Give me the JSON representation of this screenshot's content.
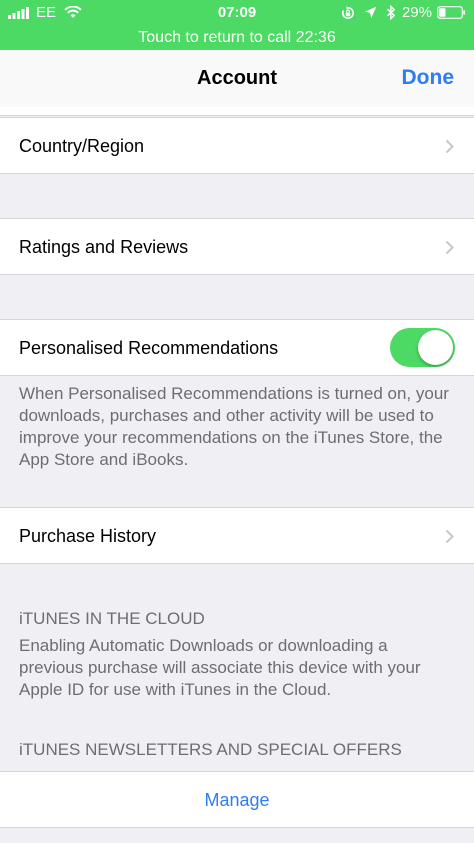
{
  "status_bar": {
    "carrier": "EE",
    "time": "07:09",
    "battery_percent": "29%",
    "battery_level": 0.29
  },
  "call_banner": {
    "text": "Touch to return to call 22:36"
  },
  "nav": {
    "title": "Account",
    "done_label": "Done"
  },
  "rows": {
    "country": "Country/Region",
    "ratings": "Ratings and Reviews",
    "personalised": "Personalised Recommendations",
    "purchase_history": "Purchase History"
  },
  "personalised_toggle_on": true,
  "personalised_footer": "When Personalised Recommendations is turned on, your downloads, purchases and other activity will be used to improve your recommendations on the iTunes Store, the App Store and iBooks.",
  "itunes_cloud": {
    "header": "iTUNES IN THE CLOUD",
    "footer": "Enabling Automatic Downloads or downloading a previous purchase will associate this device with your Apple ID for use with iTunes in the Cloud."
  },
  "newsletters": {
    "header": "iTUNES NEWSLETTERS AND SPECIAL OFFERS",
    "manage_label": "Manage"
  },
  "colors": {
    "accent": "#2f7cf6",
    "call_green": "#4cd964",
    "toggle_on": "#4cd964"
  }
}
